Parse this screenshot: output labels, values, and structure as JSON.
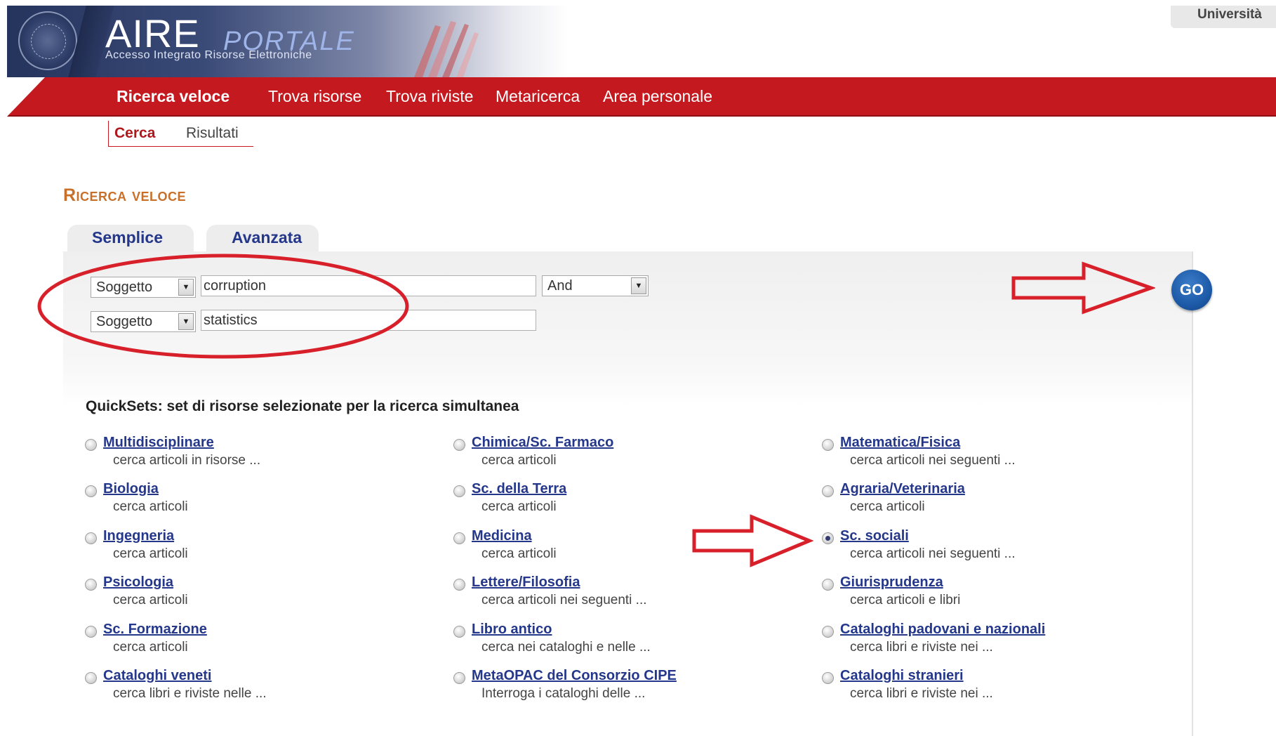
{
  "header": {
    "logo_main": "AIRE",
    "logo_accent": "PORTALE",
    "logo_subtitle": "Accesso Integrato Risorse Elettroniche",
    "institution": "Università"
  },
  "nav": {
    "items": [
      {
        "label": "Ricerca veloce",
        "active": true
      },
      {
        "label": "Trova risorse",
        "active": false
      },
      {
        "label": "Trova riviste",
        "active": false
      },
      {
        "label": "Metaricerca",
        "active": false
      },
      {
        "label": "Area personale",
        "active": false
      }
    ]
  },
  "subnav": {
    "items": [
      {
        "label": "Cerca",
        "active": true
      },
      {
        "label": "Risultati",
        "active": false
      }
    ]
  },
  "page": {
    "title": "Ricerca veloce"
  },
  "search_tabs": [
    {
      "label": "Semplice",
      "active": true
    },
    {
      "label": "Avanzata",
      "active": false
    }
  ],
  "search": {
    "row1": {
      "field": "Soggetto",
      "value": "corruption",
      "operator": "And"
    },
    "row2": {
      "field": "Soggetto",
      "value": "statistics"
    },
    "go_label": "GO"
  },
  "quicksets": {
    "heading": "QuickSets: set di risorse selezionate per la ricerca simultanea",
    "items": [
      {
        "title": "Multidisciplinare",
        "desc": "cerca articoli in risorse ...",
        "selected": false
      },
      {
        "title": "Chimica/Sc. Farmaco",
        "desc": "cerca articoli",
        "selected": false
      },
      {
        "title": "Matematica/Fisica",
        "desc": "cerca articoli nei seguenti ...",
        "selected": false
      },
      {
        "title": "Biologia",
        "desc": "cerca articoli",
        "selected": false
      },
      {
        "title": "Sc. della Terra",
        "desc": "cerca articoli",
        "selected": false
      },
      {
        "title": "Agraria/Veterinaria",
        "desc": "cerca articoli",
        "selected": false
      },
      {
        "title": "Ingegneria",
        "desc": "cerca articoli",
        "selected": false
      },
      {
        "title": "Medicina",
        "desc": "cerca articoli",
        "selected": false
      },
      {
        "title": "Sc. sociali",
        "desc": "cerca articoli nei seguenti ...",
        "selected": true
      },
      {
        "title": "Psicologia",
        "desc": "cerca articoli",
        "selected": false
      },
      {
        "title": "Lettere/Filosofia",
        "desc": "cerca articoli nei seguenti ...",
        "selected": false
      },
      {
        "title": "Giurisprudenza",
        "desc": "cerca articoli e libri",
        "selected": false
      },
      {
        "title": "Sc. Formazione",
        "desc": "cerca articoli",
        "selected": false
      },
      {
        "title": "Libro antico",
        "desc": "cerca nei cataloghi e nelle ...",
        "selected": false
      },
      {
        "title": "Cataloghi padovani e nazionali",
        "desc": "cerca libri e riviste nei ...",
        "selected": false
      },
      {
        "title": "Cataloghi veneti",
        "desc": "cerca libri e riviste nelle ...",
        "selected": false
      },
      {
        "title": "MetaOPAC del Consorzio CIPE",
        "desc": "Interroga i cataloghi delle ...",
        "selected": false
      },
      {
        "title": "Cataloghi stranieri",
        "desc": "cerca libri e riviste nei ...",
        "selected": false
      }
    ]
  },
  "colors": {
    "nav_red": "#c41a1f",
    "link_blue": "#24378a",
    "title_orange": "#c8702a",
    "annotation_red": "#d8202a",
    "go_blue": "#1d5aa7"
  }
}
